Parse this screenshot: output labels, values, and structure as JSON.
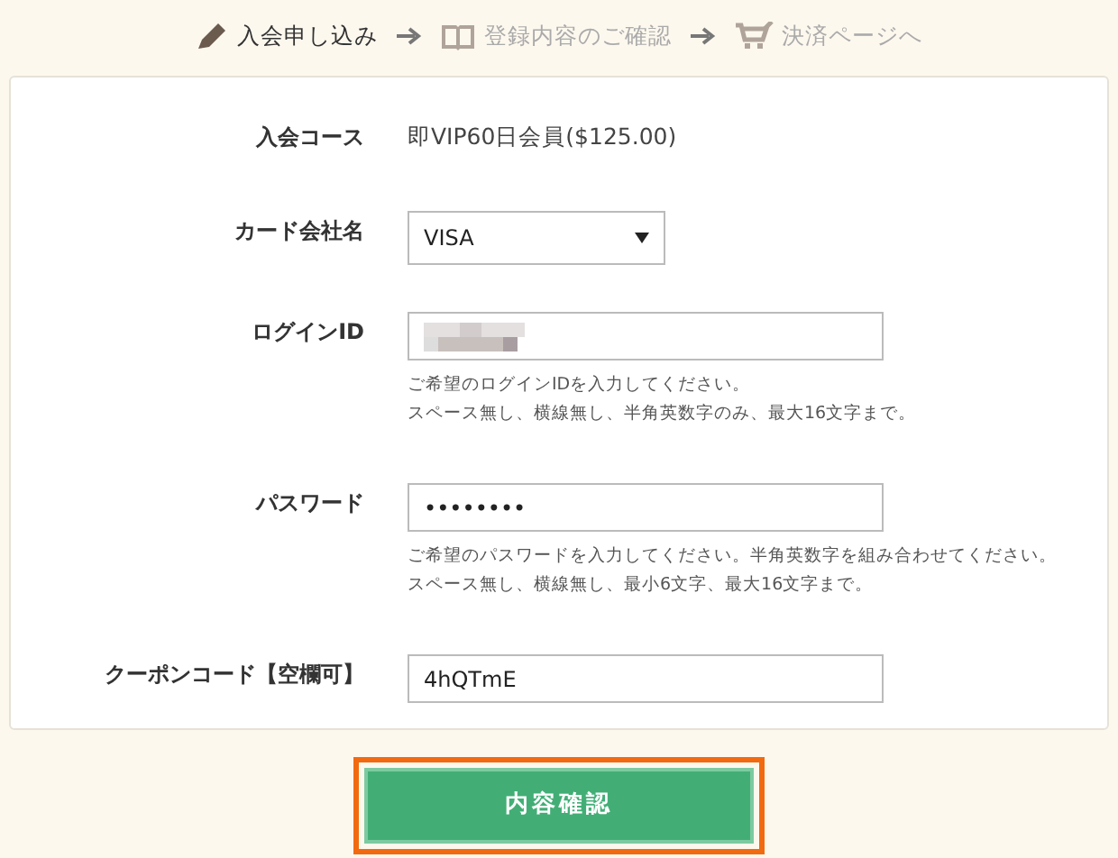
{
  "steps": [
    {
      "kind": "pencil",
      "label": "入会申し込み",
      "selected": true
    },
    {
      "kind": "book",
      "label": "登録内容のご確認",
      "selected": false
    },
    {
      "kind": "cart",
      "label": "決済ページへ",
      "selected": false
    }
  ],
  "form": {
    "rows": [
      {
        "kind": "static",
        "label": "入会コース",
        "value": "即VIP60日会員($125.00)"
      },
      {
        "kind": "select",
        "label": "カード会社名",
        "value": "VISA"
      },
      {
        "kind": "redacted",
        "label": "ログインID",
        "help": [
          "ご希望のログインIDを入力してください。",
          "スペース無し、横線無し、半角英数字のみ、最大16文字まで。"
        ]
      },
      {
        "kind": "input",
        "label": "パスワード",
        "value": "••••••••",
        "help": [
          "ご希望のパスワードを入力してください。半角英数字を組み合わせてください。",
          "スペース無し、横線無し、最小6文字、最大16文字まで。"
        ]
      },
      {
        "kind": "input",
        "label": "クーポンコード【空欄可】",
        "value": "4hQTmE"
      }
    ]
  },
  "submit": {
    "label": "内容確認",
    "focused": true
  }
}
